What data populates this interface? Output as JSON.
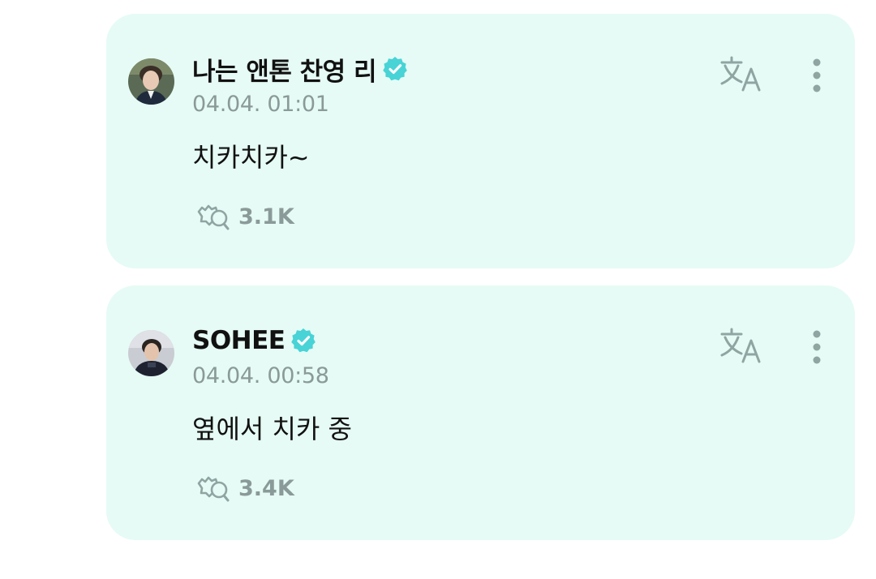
{
  "colors": {
    "card_background": "#e6fbf5",
    "verified_badge": "#48d3d6",
    "muted_text": "#8a9a98",
    "icon": "#8fa5a2"
  },
  "posts": [
    {
      "author": "나는 앤톤 찬영 리",
      "verified": true,
      "timestamp": "04.04. 01:01",
      "message": "치카치카~",
      "reaction_count": "3.1K",
      "icons": {
        "translate": "translate-icon",
        "more": "more-vertical-icon",
        "reaction": "reaction-icon"
      }
    },
    {
      "author": "SOHEE",
      "verified": true,
      "timestamp": "04.04. 00:58",
      "message": "옆에서 치카 중",
      "reaction_count": "3.4K",
      "icons": {
        "translate": "translate-icon",
        "more": "more-vertical-icon",
        "reaction": "reaction-icon"
      }
    }
  ]
}
